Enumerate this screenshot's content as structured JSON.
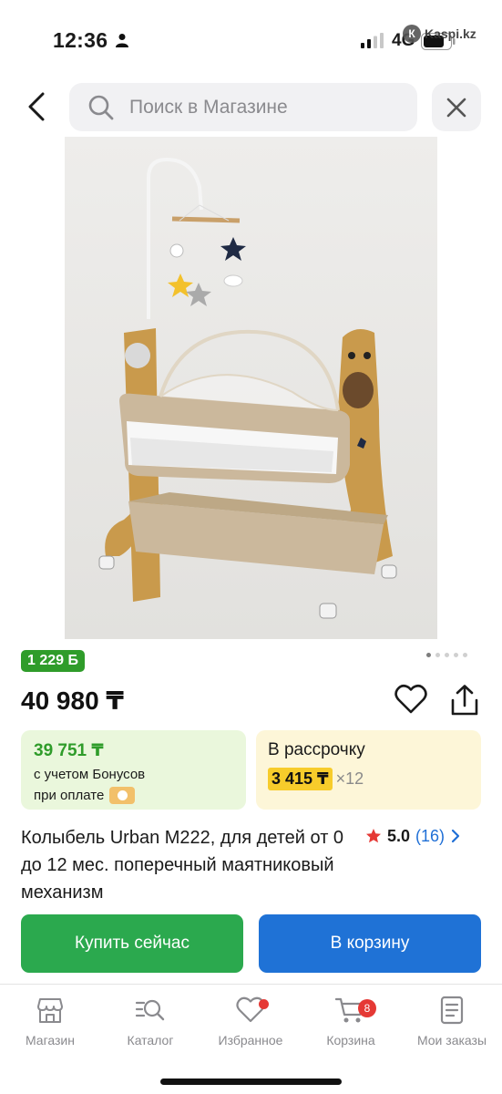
{
  "status_bar": {
    "time": "12:36",
    "network": "4G",
    "watermark": "Kaspi.kz",
    "icons": [
      "person-icon",
      "signal-icon",
      "battery-icon"
    ]
  },
  "header": {
    "search_placeholder": "Поиск в Магазине",
    "icons": [
      "back-arrow-icon",
      "search-icon",
      "close-icon"
    ]
  },
  "product": {
    "image_alt": "crib-photo",
    "carousel": {
      "total": 5,
      "active": 1
    },
    "bonus_badge": "1 229 Б",
    "price": "40 980 ₸",
    "bonus_offer": {
      "price": "39 751 ₸",
      "line1": "с учетом Бонусов",
      "line2": "при оплате"
    },
    "installment": {
      "title": "В рассрочку",
      "amount": "3 415 ₸",
      "multiplier": "×12"
    },
    "title": "Колыбель Urban M222, для детей от 0 до 12 мес. поперечный маятниковый механизм",
    "rating": {
      "value": "5.0",
      "reviews": "(16)"
    }
  },
  "actions": {
    "buy_now": "Купить сейчас",
    "add_to_cart": "В корзину"
  },
  "tabbar": {
    "tabs": [
      {
        "label": "Магазин",
        "icon": "store-icon"
      },
      {
        "label": "Каталог",
        "icon": "catalog-icon"
      },
      {
        "label": "Избранное",
        "icon": "heart-icon",
        "dot": true
      },
      {
        "label": "Корзина",
        "icon": "cart-icon",
        "badge": "8"
      },
      {
        "label": "Мои заказы",
        "icon": "orders-icon"
      }
    ]
  },
  "colors": {
    "green": "#2ba94e",
    "blue": "#1f72d6",
    "bonus_green": "#2f9c2a",
    "installment_yellow": "#f7cc2b",
    "badge_red": "#e53935"
  }
}
